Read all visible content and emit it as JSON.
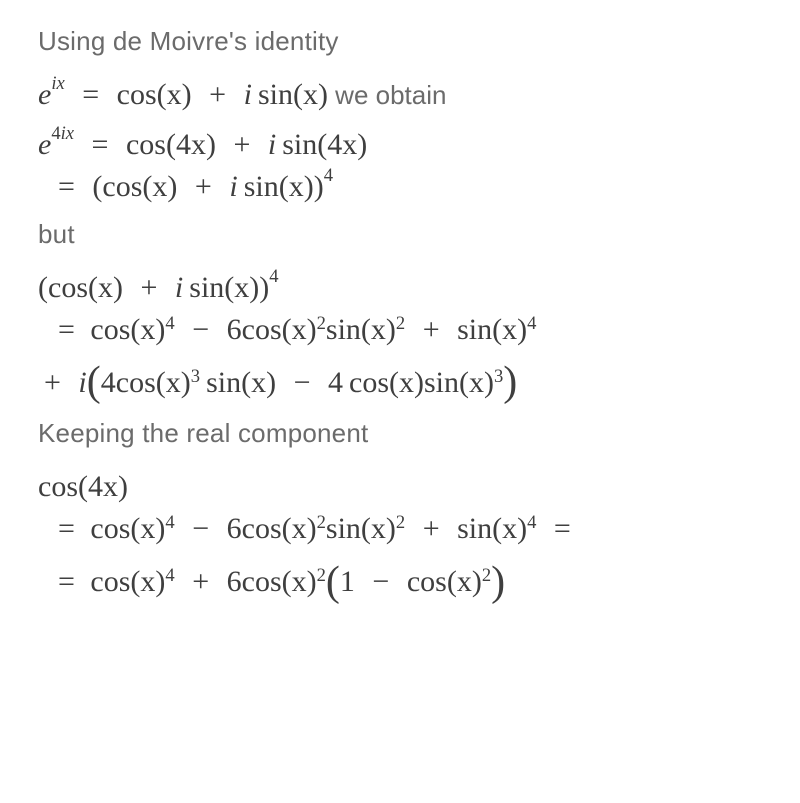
{
  "text": {
    "intro": "Using de Moivre's identity",
    "we_obtain": " we obtain",
    "but": "but",
    "keep_real": "Keeping the real component"
  },
  "eq": {
    "line1_lhs_base": "e",
    "line1_lhs_exp": "ix",
    "eq_sym": " = ",
    "cos": "cos",
    "sin": "sin",
    "x_paren": "(x)",
    "fourx_paren": "(4x)",
    "i": "i",
    "plus": " + ",
    "minus": " − ",
    "line2_lhs_exp": "4ix",
    "pow4": "4",
    "pow3": "3",
    "pow2": "2",
    "six": "6",
    "four": "4",
    "one": "1",
    "open": "(",
    "close": ")"
  }
}
